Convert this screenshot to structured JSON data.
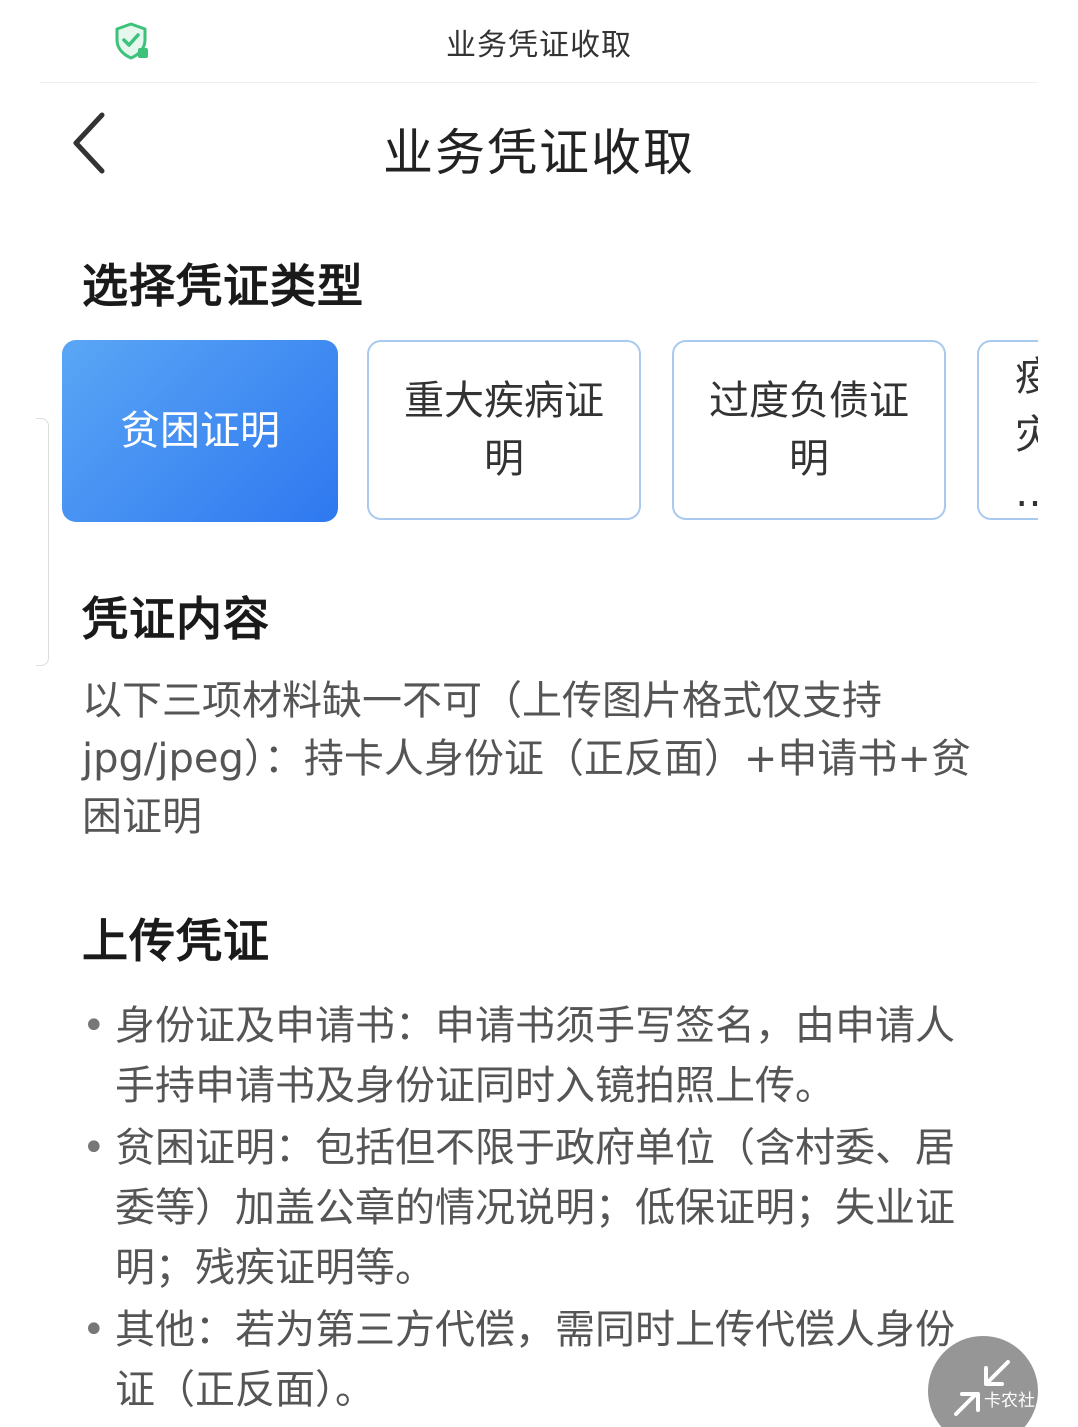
{
  "status_bar": {
    "title": "业务凭证收取",
    "icon": "shield-check-icon"
  },
  "header": {
    "title": "业务凭证收取",
    "back_icon": "chevron-left-icon"
  },
  "select_section": {
    "title": "选择凭证类型",
    "options": [
      {
        "label": "贫困证明",
        "selected": true
      },
      {
        "label": "重大疾病证明",
        "selected": false
      },
      {
        "label": "过度负债证明",
        "selected": false
      },
      {
        "label": "疫\n灾\n…",
        "selected": false
      }
    ]
  },
  "content_section": {
    "title": "凭证内容",
    "text": "以下三项材料缺一不可（上传图片格式仅支持jpg/jpeg）：持卡人身份证（正反面）+申请书+贫困证明"
  },
  "upload_section": {
    "title": "上传凭证",
    "items": [
      "身份证及申请书：申请书须手写签名，由申请人手持申请书及身份证同时入镜拍照上传。",
      "贫困证明：包括但不限于政府单位（含村委、居委等）加盖公章的情况说明；低保证明；失业证明；残疾证明等。",
      "其他：若为第三方代偿，需同时上传代偿人身份证（正反面）。"
    ]
  },
  "float_button": {
    "icon": "collapse-arrows-icon",
    "watermark": "卡农社"
  },
  "colors": {
    "accent": "#3a82f2",
    "chip_border": "#a9c9ee",
    "shield": "#3cc27a"
  }
}
